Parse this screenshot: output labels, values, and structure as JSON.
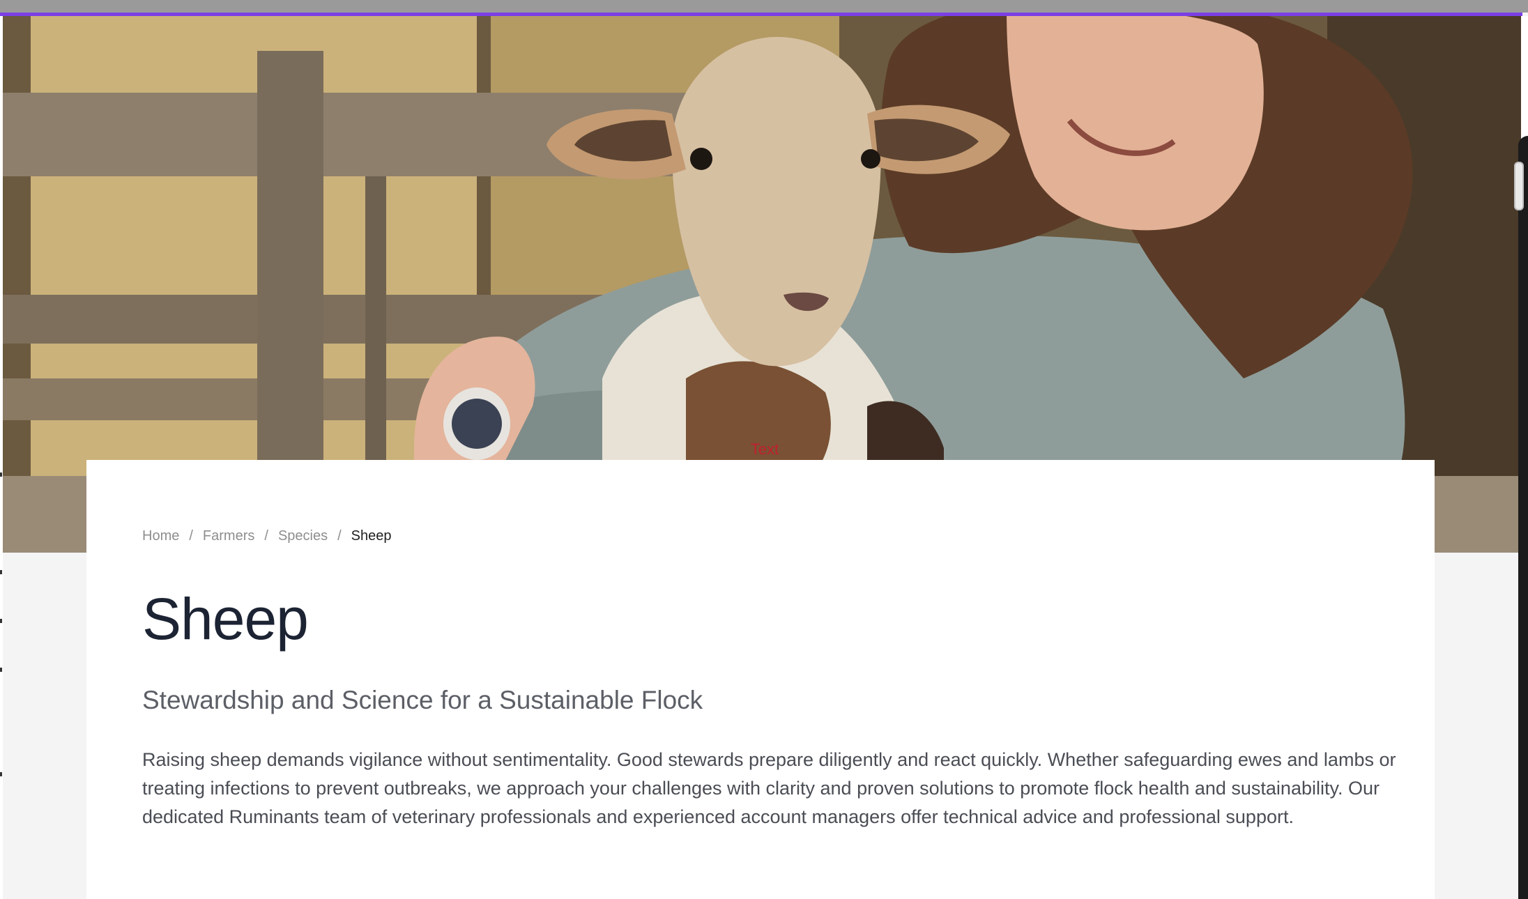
{
  "hero": {
    "image_alt": "Smiling woman holding a lamb in a barn",
    "caption": "Text"
  },
  "breadcrumb": {
    "items": [
      "Home",
      "Farmers",
      "Species"
    ],
    "current": "Sheep",
    "separator": "/"
  },
  "page": {
    "title": "Sheep",
    "subtitle": "Stewardship and Science for a Sustainable Flock",
    "body": "Raising sheep demands vigilance without sentimentality. Good stewards prepare diligently and react quickly. Whether safeguarding ewes and lambs or treating infections to prevent outbreaks, we approach your challenges with clarity and proven solutions to promote flock health and sustainability. Our dedicated Ruminants team of veterinary professionals and experienced account managers offer technical advice and professional support."
  },
  "colors": {
    "accent": "#7b3fe4",
    "title": "#1c2333",
    "caption": "#c0202f"
  }
}
